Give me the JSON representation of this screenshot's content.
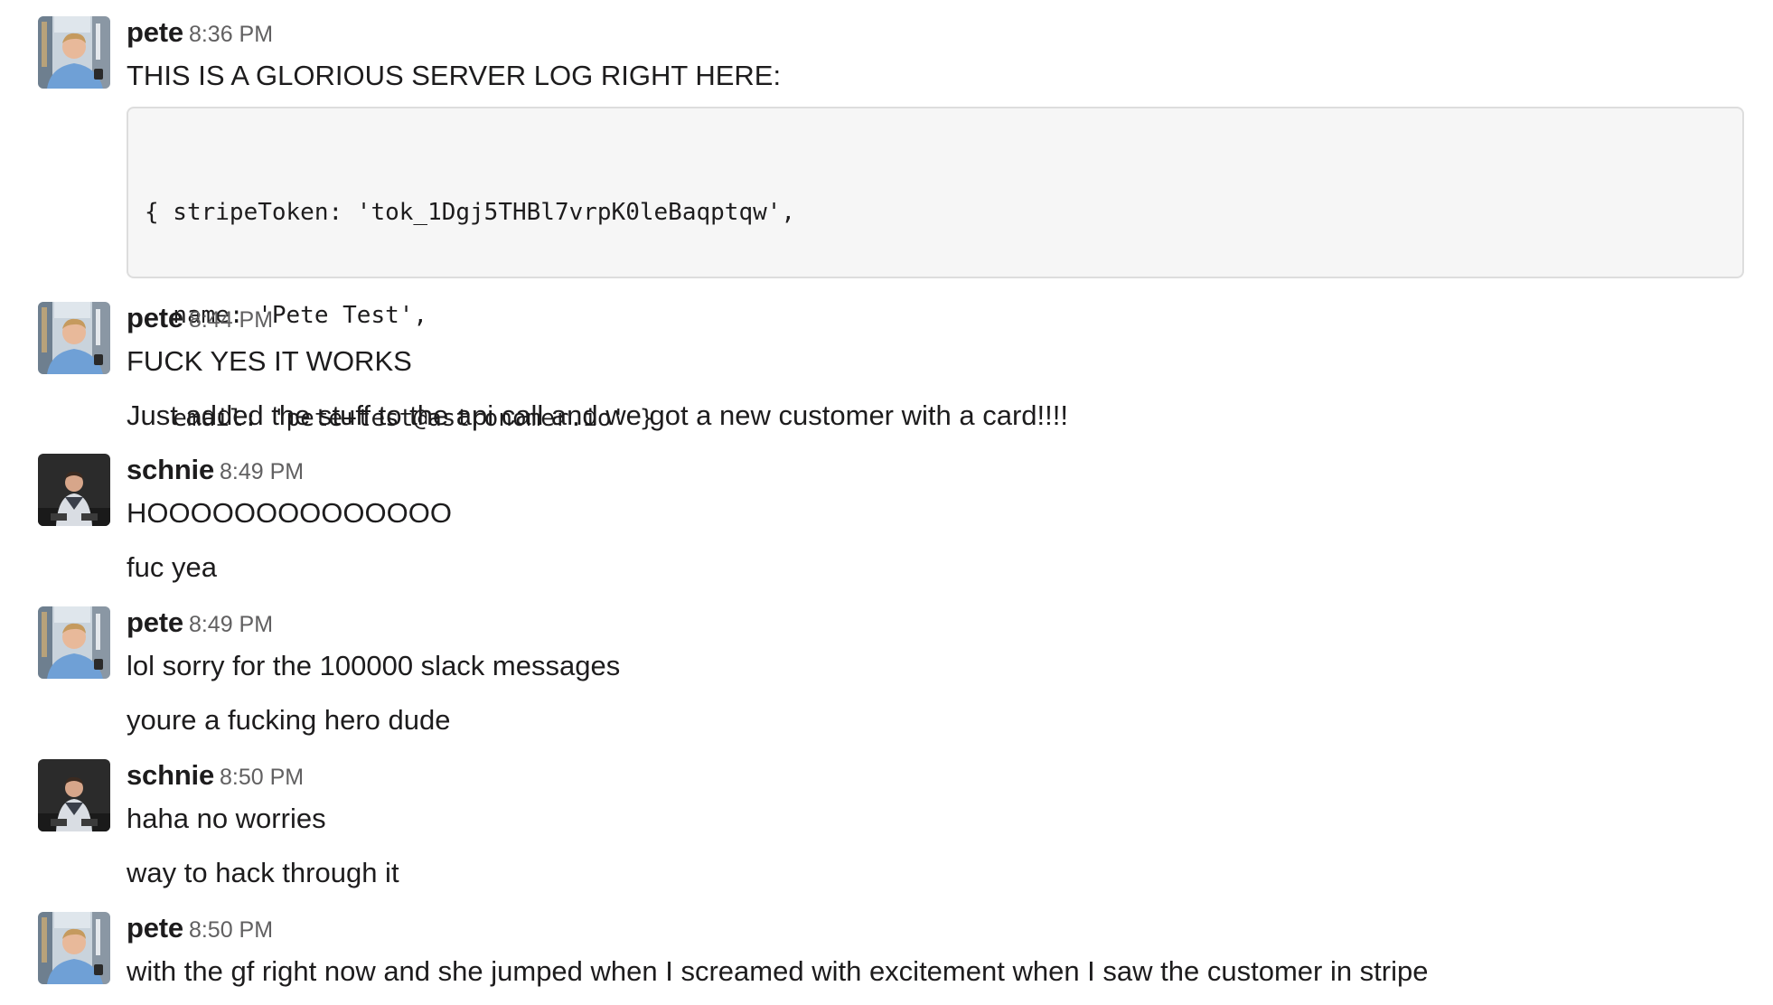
{
  "messages": [
    {
      "user": "pete",
      "time": "8:36 PM",
      "lines": [
        "THIS IS A GLORIOUS SERVER LOG RIGHT HERE:"
      ],
      "code": [
        "{ stripeToken: 'tok_1Dgj5THBl7vrpK0leBaqptqw',",
        "  name: 'Pete Test',",
        "  email: 'pete+test@astronomer.io' }"
      ]
    },
    {
      "user": "pete",
      "time": "8:44 PM",
      "lines": [
        "FUCK YES IT WORKS",
        "Just added the stuff to the api call and we got a new customer with a card!!!!"
      ]
    },
    {
      "user": "schnie",
      "time": "8:49 PM",
      "lines": [
        "HOOOOOOOOOOOOOO",
        "fuc yea"
      ]
    },
    {
      "user": "pete",
      "time": "8:49 PM",
      "lines": [
        "lol sorry for the 100000 slack messages",
        "youre a fucking hero dude"
      ]
    },
    {
      "user": "schnie",
      "time": "8:50 PM",
      "lines": [
        "haha no worries",
        "way to hack through it"
      ]
    },
    {
      "user": "pete",
      "time": "8:50 PM",
      "lines": [
        "with the gf right now and she jumped when I screamed with excitement when I saw the customer in stripe"
      ]
    }
  ],
  "colors": {
    "text": "#1d1c1d",
    "timestamp": "#616061",
    "code_bg": "#f6f6f6",
    "code_border": "#dddddd"
  },
  "icons": {
    "pete_avatar": "avatar-photo-pete",
    "schnie_avatar": "avatar-photo-schnie"
  }
}
